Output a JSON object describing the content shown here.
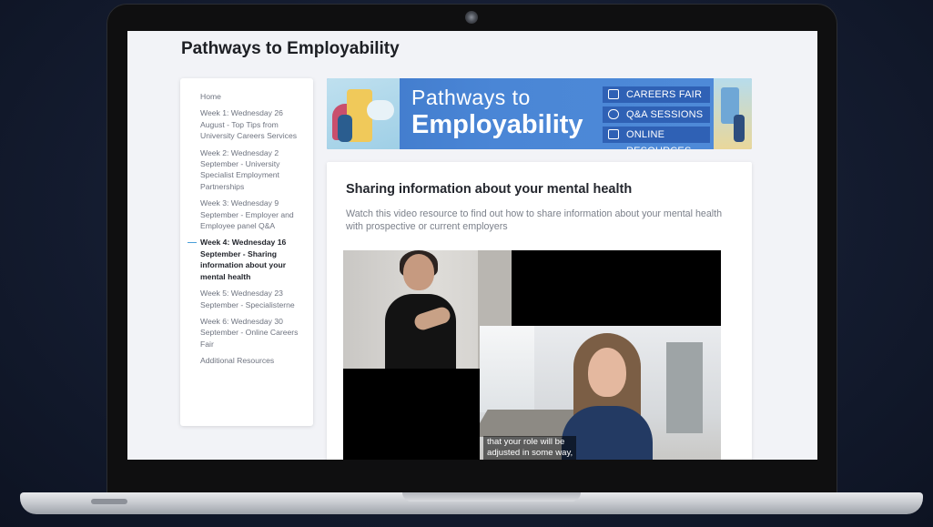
{
  "page": {
    "title": "Pathways to Employability"
  },
  "sidebar": {
    "items": [
      {
        "label": "Home"
      },
      {
        "label": "Week 1: Wednesday 26 August - Top Tips from University Careers Services"
      },
      {
        "label": "Week 2: Wednesday 2 September - University Specialist Employment Partnerships"
      },
      {
        "label": "Week 3: Wednesday 9 September - Employer and Employee panel Q&A"
      },
      {
        "label": "Week 4: Wednesday 16 September - Sharing information about your mental health",
        "active": true
      },
      {
        "label": "Week 5: Wednesday 23 September - Specialisterne"
      },
      {
        "label": "Week 6: Wednesday 30 September - Online Careers Fair"
      },
      {
        "label": "Additional Resources"
      }
    ]
  },
  "banner": {
    "line1": "Pathways to",
    "line2": "Employability",
    "pills": [
      {
        "label": "CAREERS FAIR",
        "icon": "calendar-icon"
      },
      {
        "label": "Q&A SESSIONS",
        "icon": "chat-icon"
      },
      {
        "label": "ONLINE RESOURCES",
        "icon": "monitor-icon"
      }
    ]
  },
  "content": {
    "title": "Sharing information about your mental health",
    "description": "Watch this video resource to find out how to share information about your mental health with prospective or current employers"
  },
  "video": {
    "caption_line1": "that your role will be",
    "caption_line2": "adjusted in some way,"
  },
  "colors": {
    "banner_blue": "#4a86d6",
    "pill_blue": "#2f61b5",
    "active_marker": "#4a9fd8",
    "page_bg": "#f2f3f7"
  }
}
